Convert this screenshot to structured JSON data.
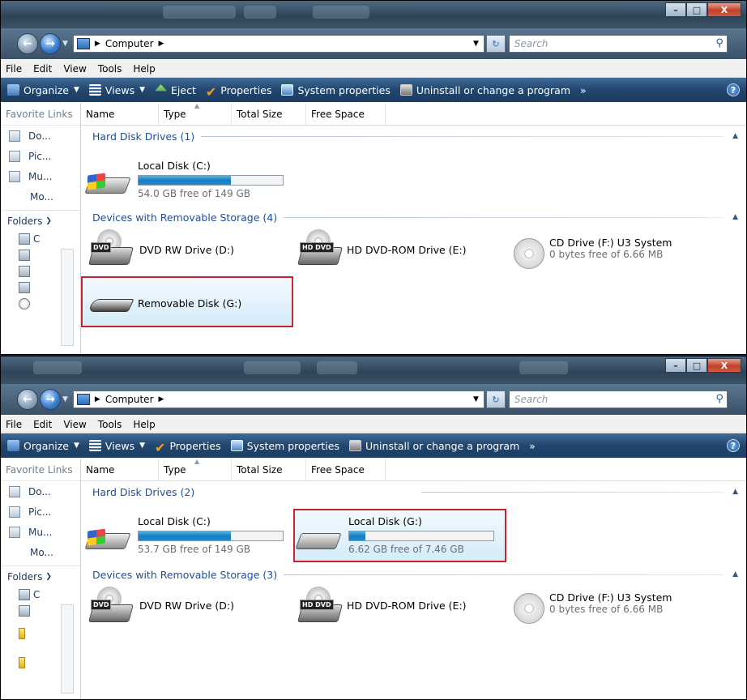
{
  "windows": [
    {
      "address": {
        "location": "Computer",
        "search_placeholder": "Search"
      },
      "menu": [
        "File",
        "Edit",
        "View",
        "Tools",
        "Help"
      ],
      "commands": [
        "Organize",
        "Views",
        "Eject",
        "Properties",
        "System properties",
        "Uninstall or change a program",
        "»"
      ],
      "nav": {
        "favorites_header": "Favorite Links",
        "favorites": [
          "Do...",
          "Pic...",
          "Mu..."
        ],
        "more": "Mo...",
        "folders": "Folders"
      },
      "columns": [
        "Name",
        "Type",
        "Total Size",
        "Free Space"
      ],
      "groups": [
        {
          "title": "Hard Disk Drives (1)"
        },
        {
          "title": "Devices with Removable Storage (4)"
        }
      ],
      "drives": {
        "c": {
          "label": "Local Disk (C:)",
          "free": "54.0 GB free of 149 GB",
          "used_fraction": 0.64
        },
        "d": {
          "label": "DVD RW Drive (D:)",
          "tag": "DVD"
        },
        "e": {
          "label": "HD DVD-ROM Drive (E:)",
          "tag": "HD DVD"
        },
        "f": {
          "label": "CD Drive (F:) U3 System",
          "free": "0 bytes free of 6.66 MB"
        },
        "g": {
          "label": "Removable Disk (G:)"
        }
      }
    },
    {
      "address": {
        "location": "Computer",
        "search_placeholder": "Search"
      },
      "menu": [
        "File",
        "Edit",
        "View",
        "Tools",
        "Help"
      ],
      "commands": [
        "Organize",
        "Views",
        "Properties",
        "System properties",
        "Uninstall or change a program",
        "»"
      ],
      "nav": {
        "favorites_header": "Favorite Links",
        "favorites": [
          "Do...",
          "Pic...",
          "Mu..."
        ],
        "more": "Mo...",
        "folders": "Folders"
      },
      "columns": [
        "Name",
        "Type",
        "Total Size",
        "Free Space"
      ],
      "groups": [
        {
          "title": "Hard Disk Drives (2)"
        },
        {
          "title": "Devices with Removable Storage (3)"
        }
      ],
      "drives": {
        "c": {
          "label": "Local Disk (C:)",
          "free": "53.7 GB free of 149 GB",
          "used_fraction": 0.64
        },
        "g": {
          "label": "Local Disk (G:)",
          "free": "6.62 GB free of 7.46 GB",
          "used_fraction": 0.11
        },
        "d": {
          "label": "DVD RW Drive (D:)",
          "tag": "DVD"
        },
        "e": {
          "label": "HD DVD-ROM Drive (E:)",
          "tag": "HD DVD"
        },
        "f": {
          "label": "CD Drive (F:) U3 System",
          "free": "0 bytes free of 6.66 MB"
        }
      }
    }
  ],
  "caption_buttons": {
    "minimize": "–",
    "maximize": "□",
    "close": "X"
  },
  "colors": {
    "highlight_border": "#c8242b",
    "accent": "#1e4d9b"
  }
}
